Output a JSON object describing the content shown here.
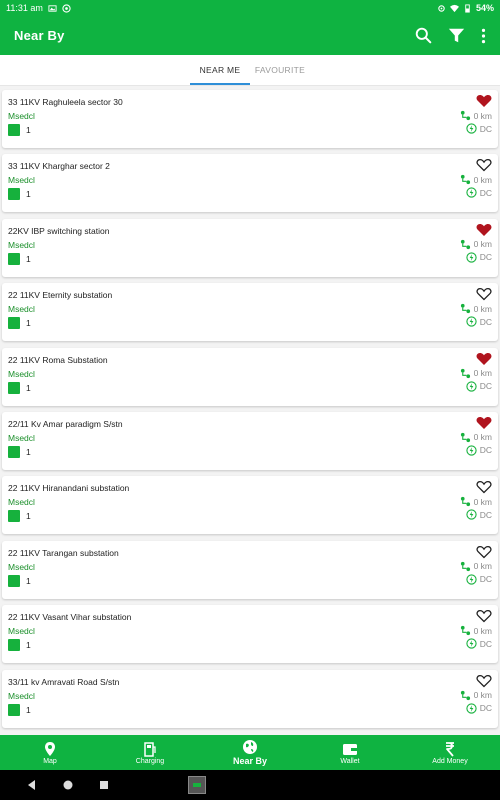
{
  "status_bar": {
    "time": "11:31 am",
    "battery": "54%"
  },
  "app_bar": {
    "title": "Near By"
  },
  "tabs": [
    {
      "label": "NEAR ME",
      "active": true
    },
    {
      "label": "FAVOURITE",
      "active": false
    }
  ],
  "stations": [
    {
      "name": "33 11KV Raghuleela sector 30",
      "operator": "Msedcl",
      "count": "1",
      "distance": "0 km",
      "type": "DC",
      "favourite": true
    },
    {
      "name": "33 11KV Kharghar sector 2",
      "operator": "Msedcl",
      "count": "1",
      "distance": "0 km",
      "type": "DC",
      "favourite": false
    },
    {
      "name": "22KV IBP switching station",
      "operator": "Msedcl",
      "count": "1",
      "distance": "0 km",
      "type": "DC",
      "favourite": true
    },
    {
      "name": "22 11KV Eternity substation",
      "operator": "Msedcl",
      "count": "1",
      "distance": "0 km",
      "type": "DC",
      "favourite": false
    },
    {
      "name": "22 11KV Roma Substation",
      "operator": "Msedcl",
      "count": "1",
      "distance": "0 km",
      "type": "DC",
      "favourite": true
    },
    {
      "name": "22/11 Kv Amar paradigm S/stn",
      "operator": "Msedcl",
      "count": "1",
      "distance": "0 km",
      "type": "DC",
      "favourite": true
    },
    {
      "name": "22 11KV Hiranandani substation",
      "operator": "Msedcl",
      "count": "1",
      "distance": "0 km",
      "type": "DC",
      "favourite": false
    },
    {
      "name": "22 11KV Tarangan substation",
      "operator": "Msedcl",
      "count": "1",
      "distance": "0 km",
      "type": "DC",
      "favourite": false
    },
    {
      "name": "22 11KV Vasant Vihar substation",
      "operator": "Msedcl",
      "count": "1",
      "distance": "0 km",
      "type": "DC",
      "favourite": false
    },
    {
      "name": "33/11 kv Amravati Road S/stn",
      "operator": "Msedcl",
      "count": "1",
      "distance": "0 km",
      "type": "DC",
      "favourite": false
    }
  ],
  "bottom_nav": [
    {
      "label": "Map",
      "icon": "map-pin-icon",
      "active": false
    },
    {
      "label": "Charging",
      "icon": "charging-station-icon",
      "active": false
    },
    {
      "label": "Near By",
      "icon": "globe-icon",
      "active": true
    },
    {
      "label": "Wallet",
      "icon": "wallet-icon",
      "active": false
    },
    {
      "label": "Add Money",
      "icon": "rupee-icon",
      "active": false
    }
  ],
  "colors": {
    "primary": "#0fb341",
    "favourite": "#b0141e",
    "operator": "#1a8f2a",
    "tab_indicator": "#2f8fd8"
  }
}
